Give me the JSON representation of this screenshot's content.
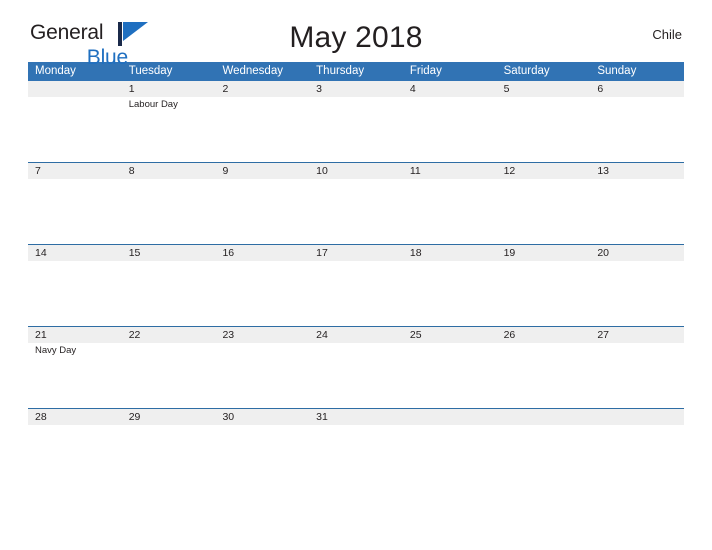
{
  "brand": {
    "line1": "General",
    "line2": "Blue",
    "flag_icon": "flag-icon",
    "flag_color": "#1f6fc0",
    "pole_color": "#1b2a4a",
    "text_color": "#231f20",
    "accent_color": "#1f6fc0"
  },
  "header": {
    "title": "May 2018",
    "region": "Chile"
  },
  "colors": {
    "header_blue": "#3173b4",
    "row_line_blue": "#2e6da4",
    "date_band_gray": "#efefef",
    "text_dark": "#231f20",
    "white": "#ffffff"
  },
  "calendar": {
    "weekdays": [
      "Monday",
      "Tuesday",
      "Wednesday",
      "Thursday",
      "Friday",
      "Saturday",
      "Sunday"
    ],
    "weeks": [
      {
        "days": [
          {
            "date": "",
            "events": []
          },
          {
            "date": "1",
            "events": [
              "Labour Day"
            ]
          },
          {
            "date": "2",
            "events": []
          },
          {
            "date": "3",
            "events": []
          },
          {
            "date": "4",
            "events": []
          },
          {
            "date": "5",
            "events": []
          },
          {
            "date": "6",
            "events": []
          }
        ]
      },
      {
        "days": [
          {
            "date": "7",
            "events": []
          },
          {
            "date": "8",
            "events": []
          },
          {
            "date": "9",
            "events": []
          },
          {
            "date": "10",
            "events": []
          },
          {
            "date": "11",
            "events": []
          },
          {
            "date": "12",
            "events": []
          },
          {
            "date": "13",
            "events": []
          }
        ]
      },
      {
        "days": [
          {
            "date": "14",
            "events": []
          },
          {
            "date": "15",
            "events": []
          },
          {
            "date": "16",
            "events": []
          },
          {
            "date": "17",
            "events": []
          },
          {
            "date": "18",
            "events": []
          },
          {
            "date": "19",
            "events": []
          },
          {
            "date": "20",
            "events": []
          }
        ]
      },
      {
        "days": [
          {
            "date": "21",
            "events": [
              "Navy Day"
            ]
          },
          {
            "date": "22",
            "events": []
          },
          {
            "date": "23",
            "events": []
          },
          {
            "date": "24",
            "events": []
          },
          {
            "date": "25",
            "events": []
          },
          {
            "date": "26",
            "events": []
          },
          {
            "date": "27",
            "events": []
          }
        ]
      },
      {
        "days": [
          {
            "date": "28",
            "events": []
          },
          {
            "date": "29",
            "events": []
          },
          {
            "date": "30",
            "events": []
          },
          {
            "date": "31",
            "events": []
          },
          {
            "date": "",
            "events": []
          },
          {
            "date": "",
            "events": []
          },
          {
            "date": "",
            "events": []
          }
        ]
      }
    ]
  }
}
